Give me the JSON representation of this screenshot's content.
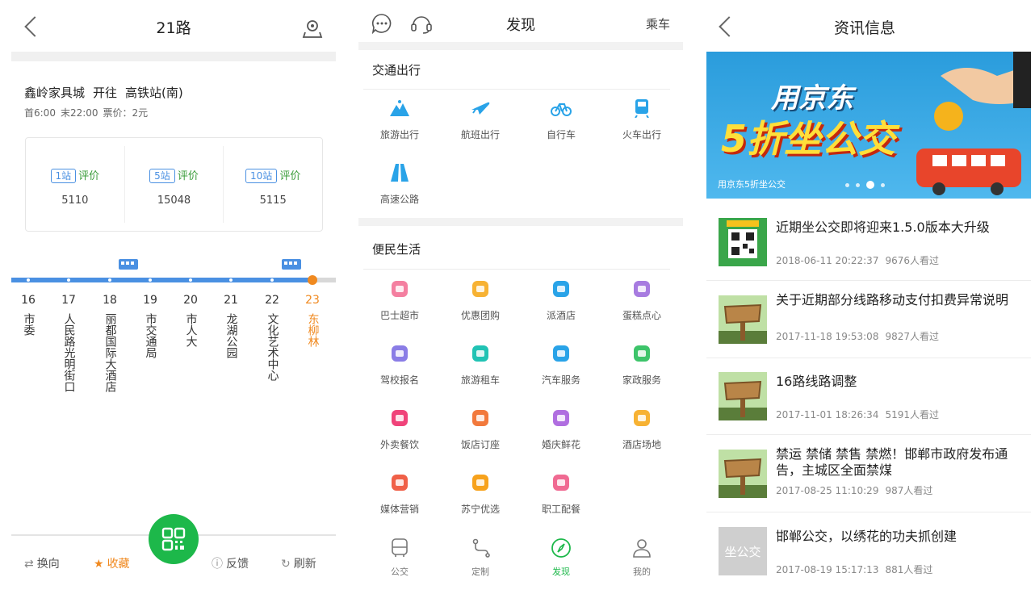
{
  "route_panel": {
    "title": "21路",
    "from": "鑫岭家具城",
    "direction_word": "开往",
    "to": "高铁站(南)",
    "first_bus": "首6:00",
    "last_bus": "末22:00",
    "fare": "票价：2元",
    "arrivals": [
      {
        "stops": "1站",
        "rate_label": "评价",
        "value": "5110"
      },
      {
        "stops": "5站",
        "rate_label": "评价",
        "value": "15048"
      },
      {
        "stops": "10站",
        "rate_label": "评价",
        "value": "5115"
      }
    ],
    "stops": [
      {
        "num": "16",
        "name": "市委"
      },
      {
        "num": "17",
        "name": "人民路光明街口"
      },
      {
        "num": "18",
        "name": "丽都国际大酒店"
      },
      {
        "num": "19",
        "name": "市交通局"
      },
      {
        "num": "20",
        "name": "市人大"
      },
      {
        "num": "21",
        "name": "龙湖公园"
      },
      {
        "num": "22",
        "name": "文化艺术中心"
      },
      {
        "num": "23",
        "name": "东柳林"
      }
    ],
    "current_stop_index": 7,
    "bottom": {
      "switch": "换向",
      "favorite": "收藏",
      "feedback": "反馈",
      "refresh": "刷新"
    },
    "colors": {
      "line": "#4a90e2",
      "accent": "#f0891f",
      "qr": "#1db84a"
    }
  },
  "discover_panel": {
    "title": "发现",
    "ride": "乘车",
    "section1": "交通出行",
    "transport": [
      {
        "label": "旅游出行",
        "icon": "mountain-icon",
        "color": "#29a3e8"
      },
      {
        "label": "航班出行",
        "icon": "plane-icon",
        "color": "#29a3e8"
      },
      {
        "label": "自行车",
        "icon": "bicycle-icon",
        "color": "#29a3e8"
      },
      {
        "label": "火车出行",
        "icon": "train-icon",
        "color": "#29a3e8"
      },
      {
        "label": "高速公路",
        "icon": "highway-icon",
        "color": "#29a3e8"
      }
    ],
    "section2": "便民生活",
    "life": [
      {
        "label": "巴士超市",
        "icon": "shop-icon",
        "color": "#f47fa0"
      },
      {
        "label": "优惠团购",
        "icon": "coupon-icon",
        "color": "#f7b233"
      },
      {
        "label": "派酒店",
        "icon": "hotel-icon",
        "color": "#29a3e8"
      },
      {
        "label": "蛋糕点心",
        "icon": "cake-icon",
        "color": "#a77be0"
      },
      {
        "label": "驾校报名",
        "icon": "driver-icon",
        "color": "#8a7de6"
      },
      {
        "label": "旅游租车",
        "icon": "rental-icon",
        "color": "#21c3b4"
      },
      {
        "label": "汽车服务",
        "icon": "car-icon",
        "color": "#29a3e8"
      },
      {
        "label": "家政服务",
        "icon": "home-icon",
        "color": "#3dc46a"
      },
      {
        "label": "外卖餐饮",
        "icon": "food-icon",
        "color": "#f0437a"
      },
      {
        "label": "饭店订座",
        "icon": "restaurant-icon",
        "color": "#f2793c"
      },
      {
        "label": "婚庆鲜花",
        "icon": "flower-icon",
        "color": "#b06ee0"
      },
      {
        "label": "酒店场地",
        "icon": "venue-icon",
        "color": "#f7b233"
      },
      {
        "label": "媒体营销",
        "icon": "media-icon",
        "color": "#f06048"
      },
      {
        "label": "苏宁优选",
        "icon": "suning-icon",
        "color": "#f7a21c"
      },
      {
        "label": "职工配餐",
        "icon": "meal-icon",
        "color": "#f06a92"
      }
    ],
    "tabs": [
      {
        "label": "公交",
        "icon": "bus-tab-icon"
      },
      {
        "label": "定制",
        "icon": "custom-tab-icon"
      },
      {
        "label": "发现",
        "icon": "discover-tab-icon"
      },
      {
        "label": "我的",
        "icon": "profile-tab-icon"
      }
    ],
    "active_tab": 2
  },
  "news_panel": {
    "title": "资讯信息",
    "banner": {
      "line1": "用京东",
      "line2": "5折坐公交",
      "caption": "用京东5折坐公交"
    },
    "items": [
      {
        "title": "近期坐公交即将迎来1.5.0版本大升级",
        "date": "2018-06-11 20:22:37",
        "views": "9676人看过",
        "thumb": "qr-thumb"
      },
      {
        "title": "关于近期部分线路移动支付扣费异常说明",
        "date": "2017-11-18 19:53:08",
        "views": "9827人看过",
        "thumb": "notice-thumb"
      },
      {
        "title": "16路线路调整",
        "date": "2017-11-01 18:26:34",
        "views": "5191人看过",
        "thumb": "notice-thumb"
      },
      {
        "title": "禁运 禁储 禁售 禁燃！邯郸市政府发布通告，主城区全面禁煤",
        "date": "2017-08-25 11:10:29",
        "views": "987人看过",
        "thumb": "notice-thumb"
      },
      {
        "title": "邯郸公交，以绣花的功夫抓创建",
        "date": "2017-08-19 15:17:13",
        "views": "881人看过",
        "thumb": "logo-thumb"
      }
    ],
    "thumb_logo_text": "坐公交"
  }
}
